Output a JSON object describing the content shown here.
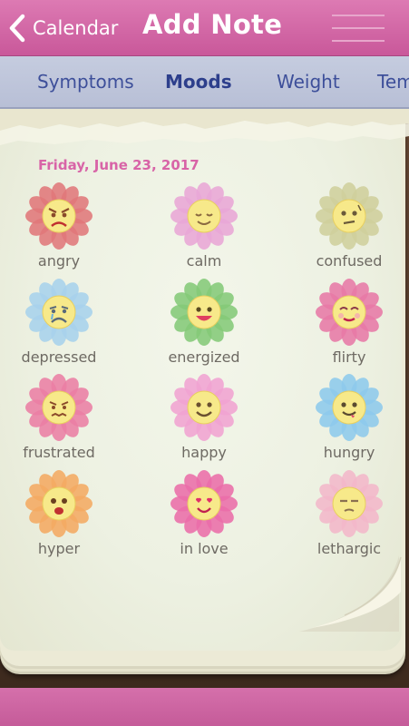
{
  "header": {
    "back_label": "Calendar",
    "title": "Add Note",
    "back_icon": "chevron-left-icon",
    "menu_icon": "hamburger-icon"
  },
  "tabs": [
    {
      "label": "Symptoms",
      "active": false
    },
    {
      "label": "Moods",
      "active": true
    },
    {
      "label": "Weight",
      "active": false
    },
    {
      "label": "Tem",
      "active": false
    }
  ],
  "date": "Friday, June 23, 2017",
  "colors": {
    "header": "#d468a8",
    "tabs_bg": "#c2c9dc",
    "tab_text": "#3d4f9a",
    "date_text": "#d864a7",
    "page": "#eef1e3"
  },
  "moods": [
    {
      "label": "angry",
      "petal": "#e0787a",
      "face": "angry"
    },
    {
      "label": "calm",
      "petal": "#e8a6d6",
      "face": "calm"
    },
    {
      "label": "confused",
      "petal": "#cfcf9c",
      "face": "confused"
    },
    {
      "label": "depressed",
      "petal": "#a7d2ec",
      "face": "depressed"
    },
    {
      "label": "energized",
      "petal": "#84c977",
      "face": "energized"
    },
    {
      "label": "flirty",
      "petal": "#e779a6",
      "face": "flirty"
    },
    {
      "label": "frustrated",
      "petal": "#ea7ea4",
      "face": "frustrated"
    },
    {
      "label": "happy",
      "petal": "#f0a3d2",
      "face": "happy"
    },
    {
      "label": "hungry",
      "petal": "#8dc9ec",
      "face": "hungry"
    },
    {
      "label": "hyper",
      "petal": "#f4aa62",
      "face": "hyper"
    },
    {
      "label": "in love",
      "petal": "#ea6da9",
      "face": "inlove"
    },
    {
      "label": "lethargic",
      "petal": "#f2b7c9",
      "face": "lethargic"
    }
  ]
}
